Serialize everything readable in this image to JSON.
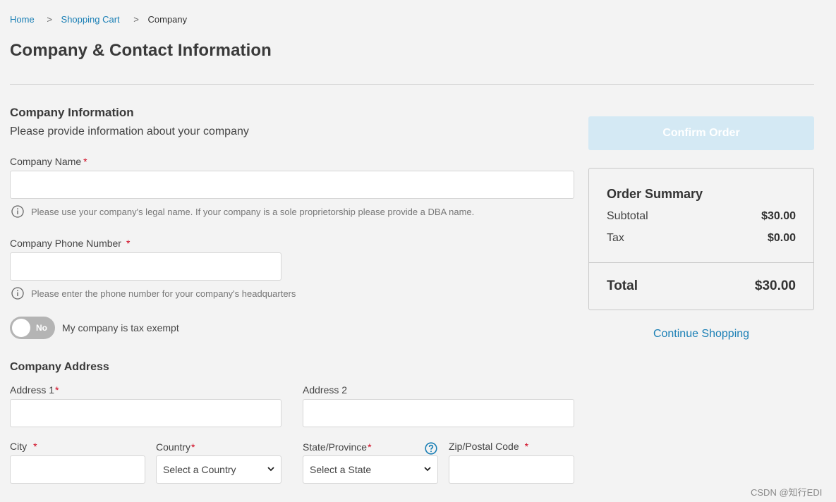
{
  "breadcrumb": {
    "items": [
      "Home",
      "Shopping Cart",
      "Company"
    ],
    "separator": ">"
  },
  "page_title": "Company & Contact Information",
  "company_info": {
    "title": "Company Information",
    "subtitle": "Please provide information about your company",
    "company_name": {
      "label": "Company Name",
      "required_mark": "*",
      "value": "",
      "hint": "Please use your company's legal name. If your company is a sole proprietorship please provide a DBA name.",
      "hint_icon": "info-icon"
    },
    "company_phone": {
      "label": "Company Phone Number",
      "required_mark": "*",
      "value": "",
      "hint": "Please enter the phone number for your company's headquarters",
      "hint_icon": "info-icon"
    },
    "tax_exempt": {
      "toggle_text": "No",
      "label": "My company is tax exempt",
      "on": false
    }
  },
  "company_address": {
    "title": "Company Address",
    "address1": {
      "label": "Address 1",
      "required_mark": "*",
      "value": ""
    },
    "address2": {
      "label": "Address 2",
      "value": ""
    },
    "city": {
      "label": "City",
      "required_mark": "*",
      "value": ""
    },
    "country": {
      "label": "Country",
      "required_mark": "*",
      "selected": "Select a Country"
    },
    "state": {
      "label": "State/Province",
      "required_mark": "*",
      "selected": "Select a State",
      "help_icon": "question-circle-icon"
    },
    "zip": {
      "label": "Zip/Postal Code",
      "required_mark": "*",
      "value": ""
    }
  },
  "order": {
    "confirm_label": "Confirm Order",
    "summary_title": "Order Summary",
    "subtotal_label": "Subtotal",
    "subtotal_value": "$30.00",
    "tax_label": "Tax",
    "tax_value": "$0.00",
    "total_label": "Total",
    "total_value": "$30.00",
    "continue_label": "Continue Shopping"
  },
  "watermark": "CSDN @知行EDI",
  "colors": {
    "link": "#1a7fb5",
    "required": "#d0021b",
    "confirm_disabled_bg": "#d4e9f4",
    "background": "#f3f3f3",
    "help_icon": "#1a7fb5"
  }
}
